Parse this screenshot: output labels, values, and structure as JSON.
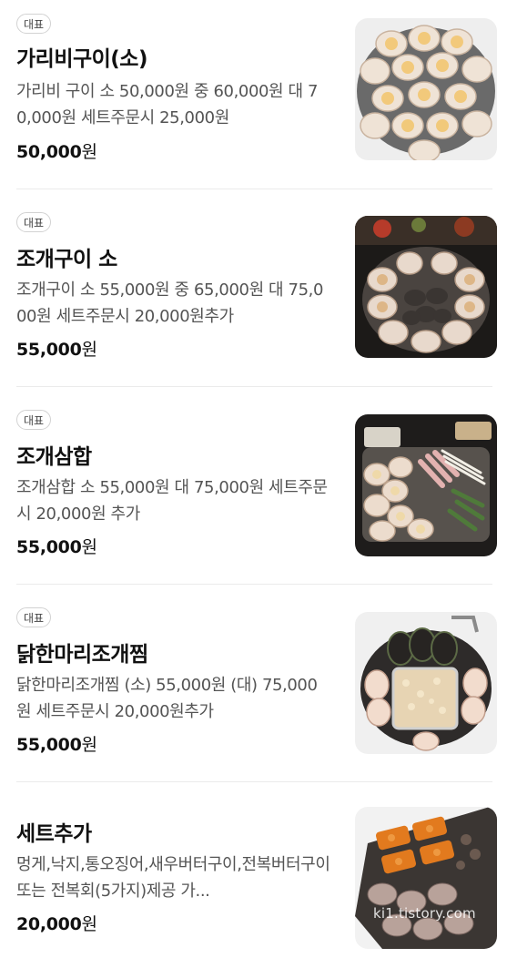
{
  "menu": {
    "items": [
      {
        "badge": "대표",
        "name": "가리비구이(소)",
        "description": "가리비 구이 소 50,000원 중 60,000원 대 70,000원 세트주문시 25,000원",
        "price_number": "50,000",
        "price_unit": "원",
        "image_icon": "grilled-scallops-photo"
      },
      {
        "badge": "대표",
        "name": "조개구이 소",
        "description": "조개구이 소 55,000원 중 65,000원 대 75,000원 세트주문시 20,000원추가",
        "price_number": "55,000",
        "price_unit": "원",
        "image_icon": "grilled-clams-photo"
      },
      {
        "badge": "대표",
        "name": "조개삼합",
        "description": "조개삼합 소 55,000원 대 75,000원 세트주문시 20,000원 추가",
        "price_number": "55,000",
        "price_unit": "원",
        "image_icon": "clam-samhap-photo"
      },
      {
        "badge": "대표",
        "name": "닭한마리조개찜",
        "description": "닭한마리조개찜 (소) 55,000원 (대) 75,000원 세트주문시 20,000원추가",
        "price_number": "55,000",
        "price_unit": "원",
        "image_icon": "chicken-clam-stew-photo"
      },
      {
        "badge": "",
        "name": "세트추가",
        "description": "멍게,낙지,통오징어,새우버터구이,전복버터구이또는 전복회(5가지)제공 가...",
        "price_number": "20,000",
        "price_unit": "원",
        "image_icon": "seafood-set-photo",
        "image_watermark": "ki1.tistory.com"
      }
    ]
  },
  "colors": {
    "title": "#111111",
    "description": "#545454",
    "divider": "#ebebeb",
    "badge_border": "#d2d2d2"
  }
}
